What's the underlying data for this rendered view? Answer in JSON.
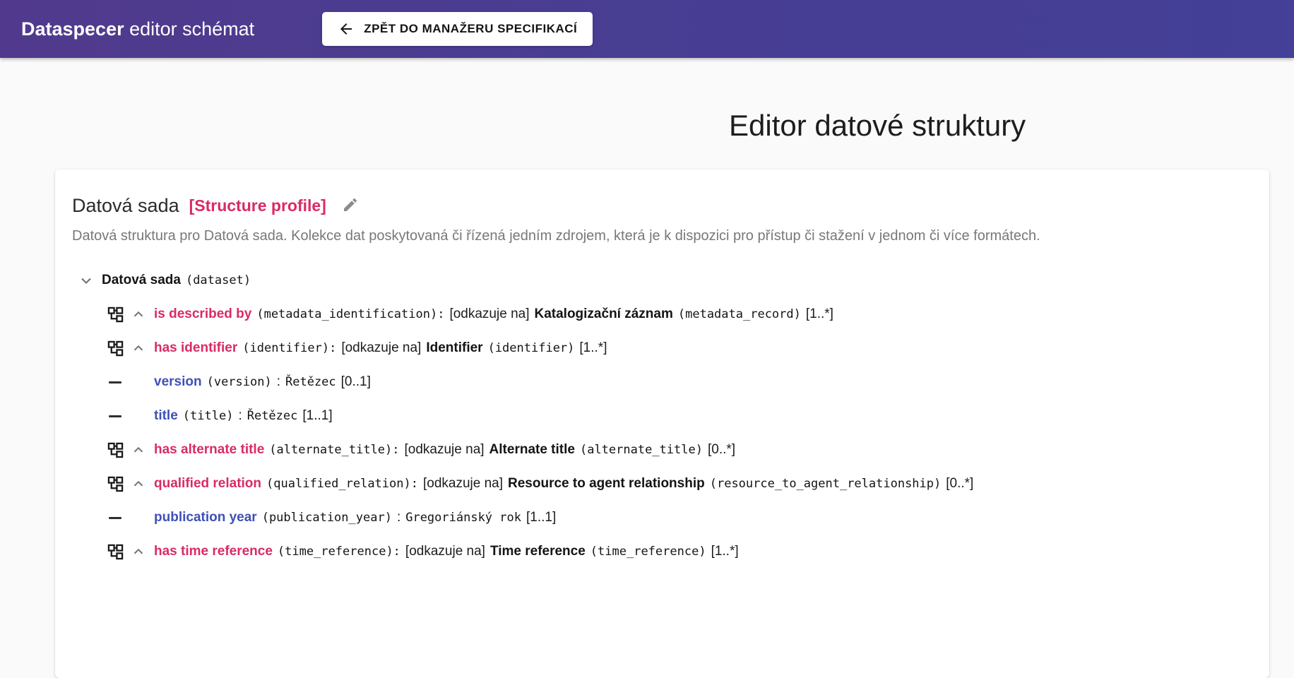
{
  "header": {
    "brand_bold": "Dataspecer",
    "brand_rest": " editor schémat",
    "back_button_label": "ZPĚT DO MANAŽERU SPECIFIKACÍ"
  },
  "page": {
    "title": "Editor datové struktury"
  },
  "card": {
    "title": "Datová sada",
    "profile_tag": "[Structure profile]",
    "description": "Datová struktura pro Datová sada. Kolekce dat poskytovaná či řízená jedním zdrojem, která je k dispozici pro přístup či stažení v jednom či více formátech."
  },
  "tree": {
    "root": {
      "label": "Datová sada",
      "technical": "(dataset)"
    },
    "rows": [
      {
        "kind": "association",
        "label": "is described by",
        "technical": "(metadata_identification):",
        "link_text": "[odkazuje na]",
        "target": "Katalogizační záznam",
        "target_technical": "(metadata_record)",
        "cardinality": "[1..*]"
      },
      {
        "kind": "association",
        "label": "has identifier",
        "technical": "(identifier):",
        "link_text": "[odkazuje na]",
        "target": "Identifier",
        "target_technical": "(identifier)",
        "cardinality": "[1..*]"
      },
      {
        "kind": "attribute",
        "label": "version",
        "technical": "(version)",
        "separator": ":",
        "datatype": "Řetězec",
        "cardinality": "[0..1]"
      },
      {
        "kind": "attribute",
        "label": "title",
        "technical": "(title)",
        "separator": ":",
        "datatype": "Řetězec",
        "cardinality": "[1..1]"
      },
      {
        "kind": "association",
        "label": "has alternate title",
        "technical": "(alternate_title):",
        "link_text": "[odkazuje na]",
        "target": "Alternate title",
        "target_technical": "(alternate_title)",
        "cardinality": "[0..*]"
      },
      {
        "kind": "association",
        "label": "qualified relation",
        "technical": "(qualified_relation):",
        "link_text": "[odkazuje na]",
        "target": "Resource to agent relationship",
        "target_technical": "(resource_to_agent_relationship)",
        "cardinality": "[0..*]"
      },
      {
        "kind": "attribute",
        "label": "publication year",
        "technical": "(publication_year)",
        "separator": ":",
        "datatype": "Gregoriánský rok",
        "cardinality": "[1..1]"
      },
      {
        "kind": "association",
        "label": "has time reference",
        "technical": "(time_reference):",
        "link_text": "[odkazuje na]",
        "target": "Time reference",
        "target_technical": "(time_reference)",
        "cardinality": "[1..*]"
      }
    ]
  },
  "icons": {
    "back-arrow": "←",
    "edit-pencil": "✎",
    "chevron-down": "∨",
    "chevron-up": "∧",
    "association": "hierarchy-squares",
    "attribute": "dash"
  },
  "colors": {
    "appbar_gradient_start": "#513a8d",
    "appbar_gradient_end": "#443f97",
    "association_pink": "#d92b63",
    "attribute_indigo": "#3f51b5",
    "text_dark": "#1c1c1c",
    "text_gray": "#787878",
    "card_bg": "#ffffff",
    "page_bg": "#fafafa"
  }
}
